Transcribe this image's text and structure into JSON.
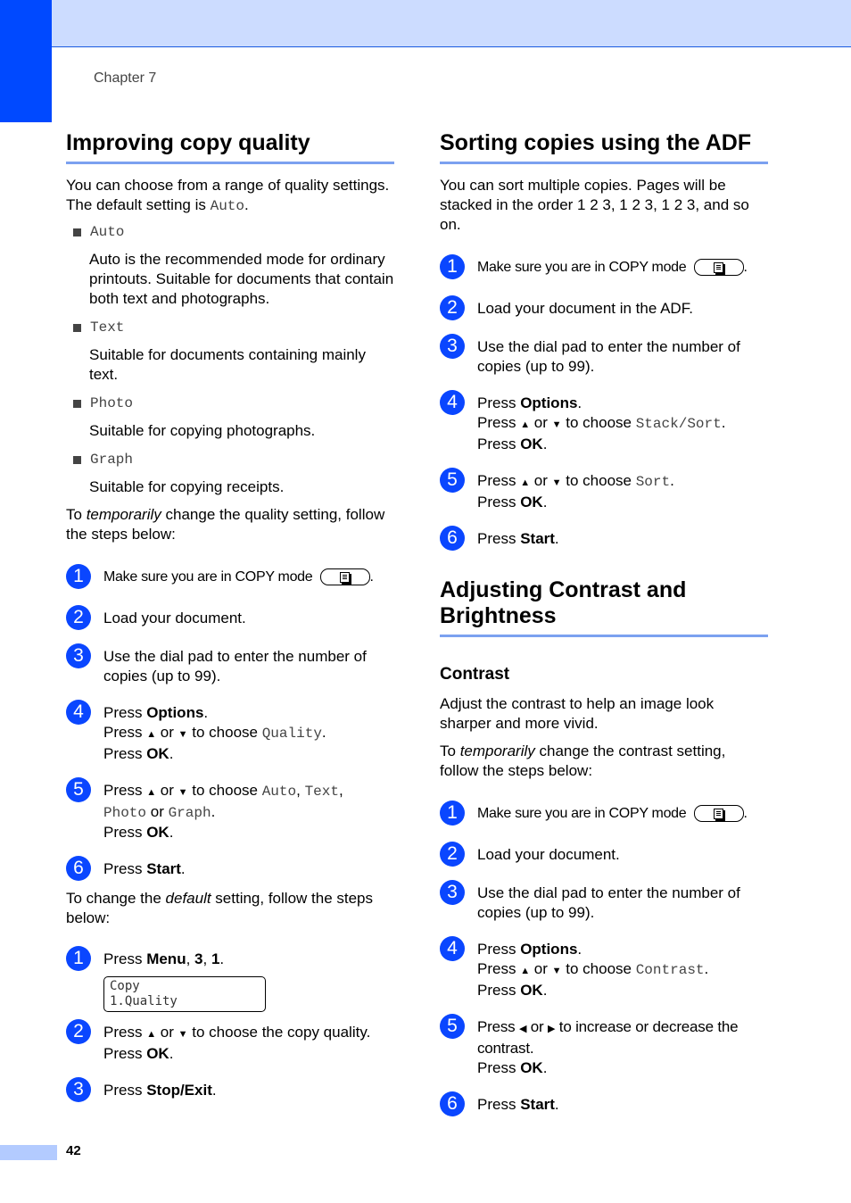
{
  "header": {
    "chapter": "Chapter 7"
  },
  "footer": {
    "page_number": "42"
  },
  "colors": {
    "accent": "#0049ff",
    "band": "#ccdcff",
    "rule": "#7ba1f0",
    "step_circle": "#0a46ff"
  },
  "icons": {
    "copy_mode_key": "copy-mode-key-icon",
    "up": "▲",
    "down": "▼",
    "left": "◀",
    "right": "▶"
  },
  "left": {
    "title": "Improving copy quality",
    "intro_1": "You can choose from a range of quality settings. The default setting is ",
    "intro_default": "Auto",
    "intro_end": ".",
    "options": [
      {
        "name": "Auto",
        "desc": "Auto is the recommended mode for ordinary printouts. Suitable for documents that contain both text and photographs."
      },
      {
        "name": "Text",
        "desc": "Suitable for documents containing mainly text."
      },
      {
        "name": "Photo",
        "desc": "Suitable for copying photographs."
      },
      {
        "name": "Graph",
        "desc": "Suitable for copying receipts."
      }
    ],
    "temp_pre": "To ",
    "temp_em": "temporarily",
    "temp_post": " change the quality setting, follow the steps below:",
    "temp_steps": {
      "s1": "Make sure you are in COPY mode",
      "s1_end": ".",
      "s2": "Load your document.",
      "s3": "Use the dial pad to enter the number of copies (up to 99).",
      "press": "Press ",
      "options": "Options",
      "ok": "OK",
      "start": "Start",
      "or": " or ",
      "to_choose": " to choose ",
      "quality": "Quality",
      "auto": "Auto",
      "text": "Text",
      "photo": "Photo",
      "graph": "Graph",
      "comma": ", ",
      "period": "."
    },
    "default_pre": "To change the ",
    "default_em": "default",
    "default_post": " setting, follow the steps below:",
    "default_steps": {
      "menu": "Menu",
      "three": "3",
      "one": "1",
      "lcd_line1": "Copy",
      "lcd_line2": "1.Quality",
      "s2_text": " to choose the copy quality.",
      "stop": "Stop/Exit"
    }
  },
  "right": {
    "title": "Sorting copies using the ADF",
    "intro": "You can sort multiple copies. Pages will be stacked in the order 1 2 3, 1 2 3, 1 2 3, and so on.",
    "steps": {
      "s1": "Make sure you are in COPY mode",
      "s2": "Load your document in the ADF.",
      "s3": "Use the dial pad to enter the number of copies (up to 99).",
      "stack_sort": "Stack/Sort",
      "sort": "Sort"
    },
    "title2": "Adjusting Contrast and Brightness",
    "sub": "Contrast",
    "contrast_intro": "Adjust the contrast to help an image look sharper and more vivid.",
    "temp_post": " change the contrast setting, follow the steps below:",
    "contrast_steps": {
      "s2": "Load your document.",
      "contrast": "Contrast",
      "s5_text": " to increase or decrease the contrast."
    }
  }
}
